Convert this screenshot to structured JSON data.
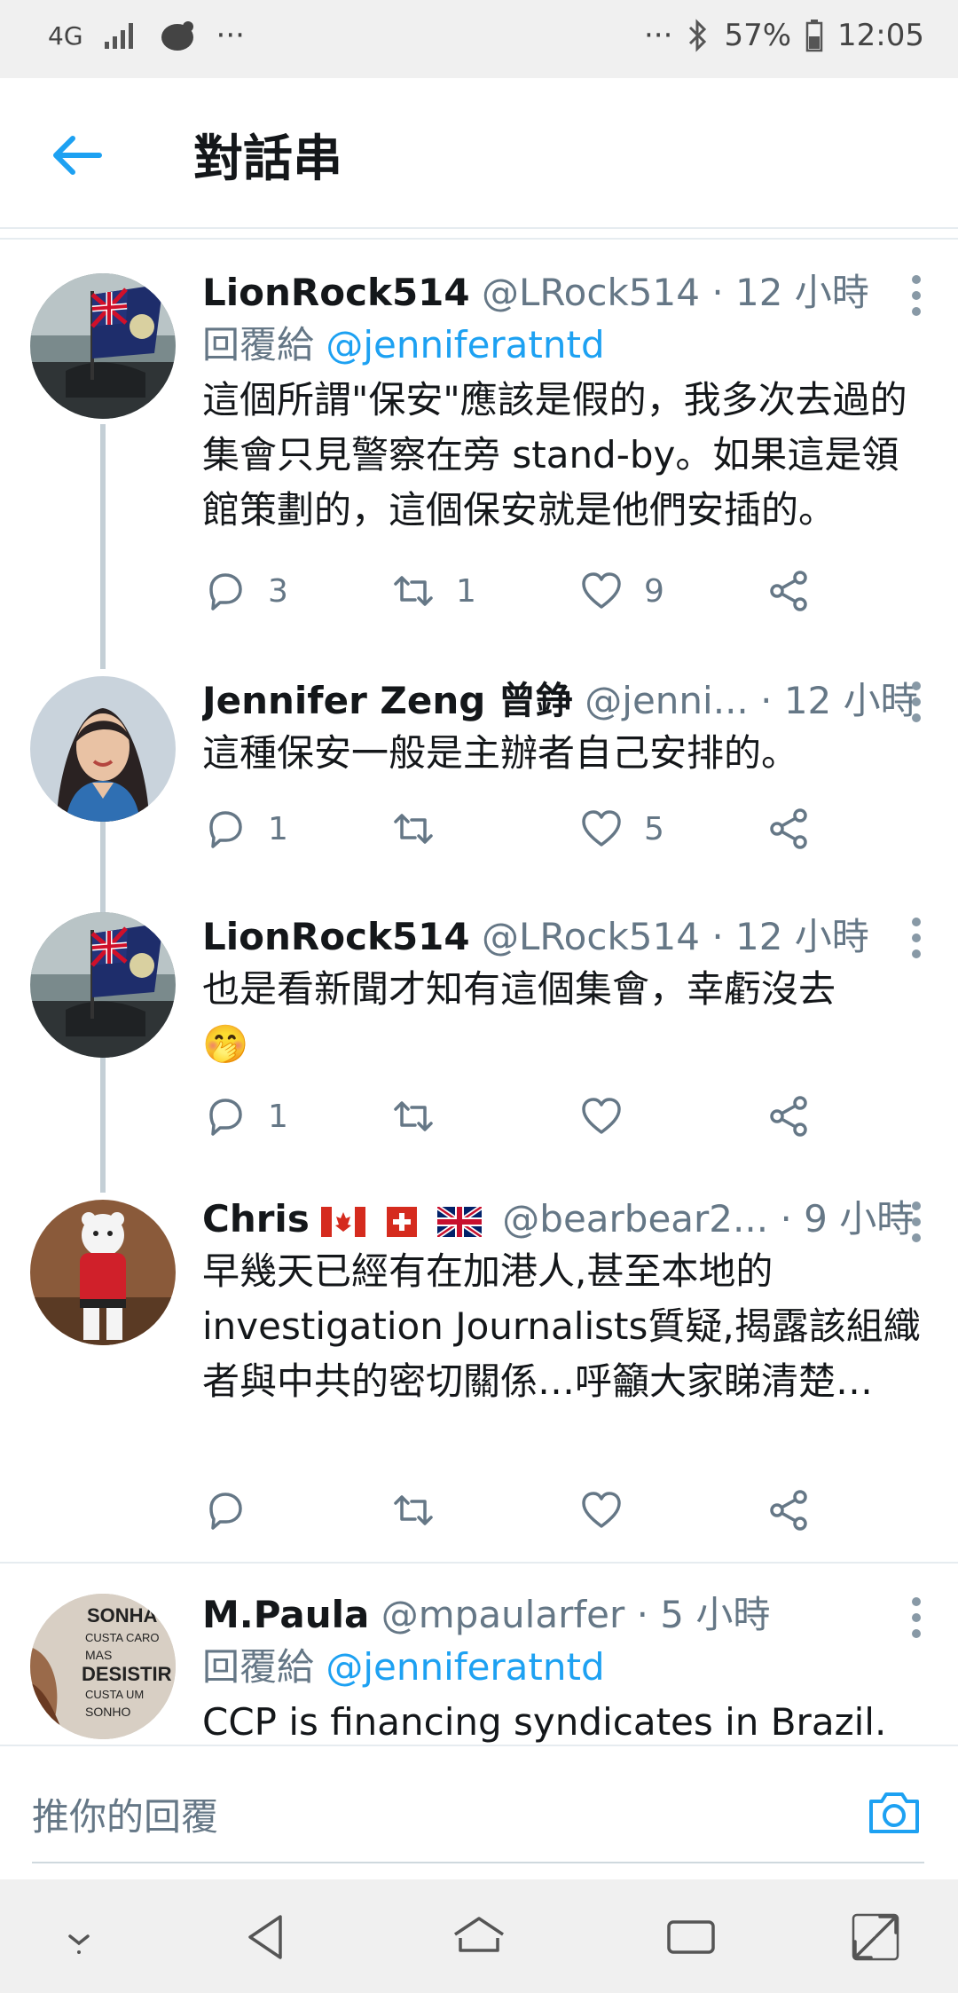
{
  "status_bar": {
    "network": "4G",
    "dots_left": "···",
    "dots_right": "···",
    "battery": "57%",
    "time": "12:05"
  },
  "header": {
    "title": "對話串"
  },
  "tweets": [
    {
      "name": "LionRock514",
      "handle": "@LRock514",
      "time": "· 12 小時",
      "reply_to_prefix": "回覆給",
      "reply_to": "@jenniferatntd",
      "text": "這個所謂\"保安\"應該是假的，我多次去過的集會只見警察在旁 stand-by。如果這是領館策劃的，這個保安就是他們安插的。",
      "replies": "3",
      "retweets": "1",
      "likes": "9"
    },
    {
      "name": "Jennifer Zeng 曾錚",
      "handle": "@jenni...",
      "time": "· 12 小時",
      "text": "這種保安一般是主辦者自己安排的。",
      "replies": "1",
      "retweets": "",
      "likes": "5"
    },
    {
      "name": "LionRock514",
      "handle": "@LRock514",
      "time": "· 12 小時",
      "text": "也是看新聞才知有這個集會，幸虧沒去",
      "emoji": "🤭",
      "replies": "1",
      "retweets": "",
      "likes": ""
    },
    {
      "name": "Chris",
      "handle": "@bearbear2...",
      "time": "· 9 小時",
      "text": "早幾天已經有在加港人,甚至本地的investigation Journalists質疑,揭露該組織者與中共的密切關係…呼籲大家睇清楚…",
      "replies": "",
      "retweets": "",
      "likes": ""
    },
    {
      "name": "M.Paula",
      "handle": "@mpaularfer",
      "time": "· 5 小時",
      "reply_to_prefix": "回覆給",
      "reply_to": "@jenniferatntd",
      "text": "CCP is financing syndicates in Brazil.",
      "avatar_text": [
        "SONHA",
        "CUSTA CARO",
        "MAS",
        "DESISTIR",
        "CUSTA UM",
        "SONHO"
      ]
    }
  ],
  "composer": {
    "placeholder": "推你的回覆"
  },
  "colors": {
    "accent": "#1da1f2",
    "secondary_text": "#657786"
  }
}
